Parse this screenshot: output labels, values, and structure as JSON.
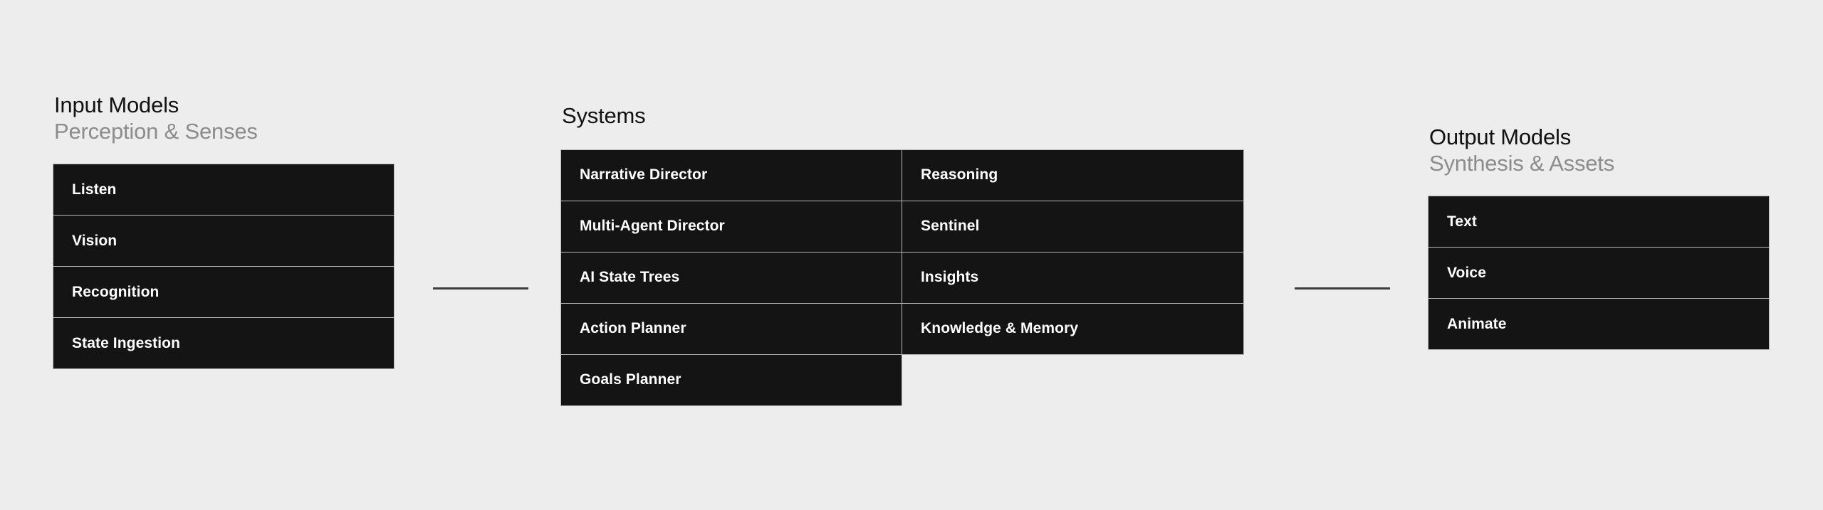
{
  "diagram": {
    "background_color": "#ededed",
    "node_fill_color": "#141414",
    "node_text_color": "#ffffff",
    "node_border_color": "#b9b9b9",
    "title_color": "#111111",
    "subtitle_color": "#8c8c8c",
    "connector_color": "#3c3c3c"
  },
  "columns": {
    "input": {
      "title": "Input Models",
      "subtitle": "Perception & Senses",
      "items": [
        {
          "label": "Listen"
        },
        {
          "label": "Vision"
        },
        {
          "label": "Recognition"
        },
        {
          "label": "State Ingestion"
        }
      ]
    },
    "systems": {
      "title": "Systems",
      "subtitle": "",
      "left_items": [
        {
          "label": "Narrative Director"
        },
        {
          "label": "Multi-Agent Director"
        },
        {
          "label": "AI State Trees"
        },
        {
          "label": "Action Planner"
        },
        {
          "label": "Goals Planner"
        }
      ],
      "right_items": [
        {
          "label": "Reasoning"
        },
        {
          "label": "Sentinel"
        },
        {
          "label": "Insights"
        },
        {
          "label": "Knowledge & Memory"
        }
      ]
    },
    "output": {
      "title": "Output Models",
      "subtitle": "Synthesis & Assets",
      "items": [
        {
          "label": "Text"
        },
        {
          "label": "Voice"
        },
        {
          "label": "Animate"
        }
      ]
    }
  },
  "connectors": [
    {
      "name": "input-to-systems"
    },
    {
      "name": "systems-to-output"
    }
  ]
}
